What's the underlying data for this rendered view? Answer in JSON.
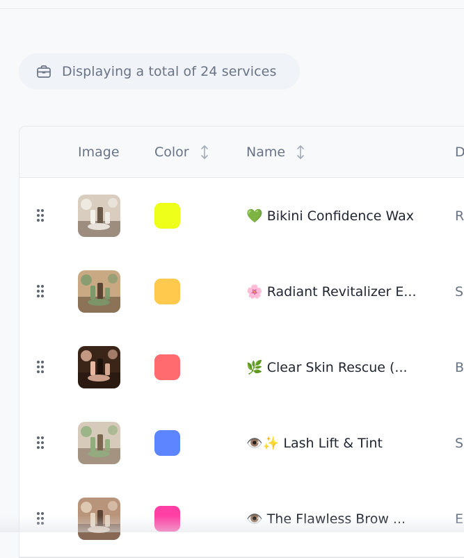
{
  "summary": {
    "text": "Displaying a total of 24 services",
    "icon": "briefcase-icon"
  },
  "table": {
    "columns": {
      "image": "Image",
      "color": "Color",
      "name": "Name",
      "description_partial": "D"
    },
    "rows": [
      {
        "name": "💚 Bikini Confidence Wax",
        "color": "#eeff1a",
        "desc_partial": "R",
        "thumb": {
          "bg": "#d8cdbf",
          "accent": "#f4f0ea",
          "dark": "#6b5a49"
        }
      },
      {
        "name": "🌸 Radiant Revitalizer E...",
        "color": "#ffc94d",
        "desc_partial": "S",
        "thumb": {
          "bg": "#c9a984",
          "accent": "#7a9a6b",
          "dark": "#5a4532"
        }
      },
      {
        "name": "🌿 Clear Skin Rescue (...",
        "color": "#ff6b6e",
        "desc_partial": "B",
        "thumb": {
          "bg": "#3b2418",
          "accent": "#e7b7a0",
          "dark": "#1e120c"
        }
      },
      {
        "name": "👁️✨ Lash Lift & Tint",
        "color": "#5c85ff",
        "desc_partial": "S",
        "thumb": {
          "bg": "#d6cbbb",
          "accent": "#8fae7c",
          "dark": "#7b6650"
        }
      },
      {
        "name": "👁️ The Flawless Brow ...",
        "color": "#ff3fa4",
        "desc_partial": "E",
        "thumb": {
          "bg": "#b8957a",
          "accent": "#e6d4c1",
          "dark": "#5c4434"
        }
      }
    ]
  }
}
